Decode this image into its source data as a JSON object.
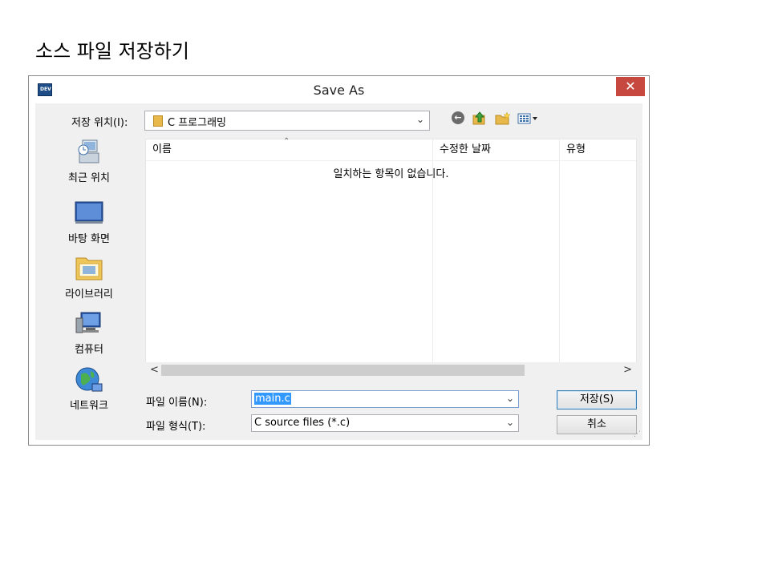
{
  "slide_title": "소스 파일 저장하기",
  "window": {
    "title": "Save As",
    "close_glyph": "✕",
    "app_icon_text": "DEV"
  },
  "look_in": {
    "label": "저장 위치(I):",
    "folder": "C 프로그래밍"
  },
  "toolbar": {
    "icons": [
      "back-icon",
      "up-folder-icon",
      "new-folder-icon",
      "views-menu-icon"
    ]
  },
  "places": [
    {
      "label": "최근 위치",
      "icon": "recent-places-icon"
    },
    {
      "label": "바탕 화면",
      "icon": "desktop-icon"
    },
    {
      "label": "라이브러리",
      "icon": "libraries-icon"
    },
    {
      "label": "컴퓨터",
      "icon": "computer-icon"
    },
    {
      "label": "네트워크",
      "icon": "network-icon"
    }
  ],
  "file_list": {
    "columns": [
      "이름",
      "수정한 날짜",
      "유형"
    ],
    "empty_message": "일치하는 항목이 없습니다."
  },
  "filename": {
    "label": "파일 이름(N):",
    "value": "main.c"
  },
  "filetype": {
    "label": "파일 형식(T):",
    "value": "C source files (*.c)"
  },
  "buttons": {
    "save": "저장(S)",
    "cancel": "취소"
  },
  "colors": {
    "close_button": "#c7483f",
    "selection": "#3399ff",
    "folder": "#e8b84a"
  }
}
